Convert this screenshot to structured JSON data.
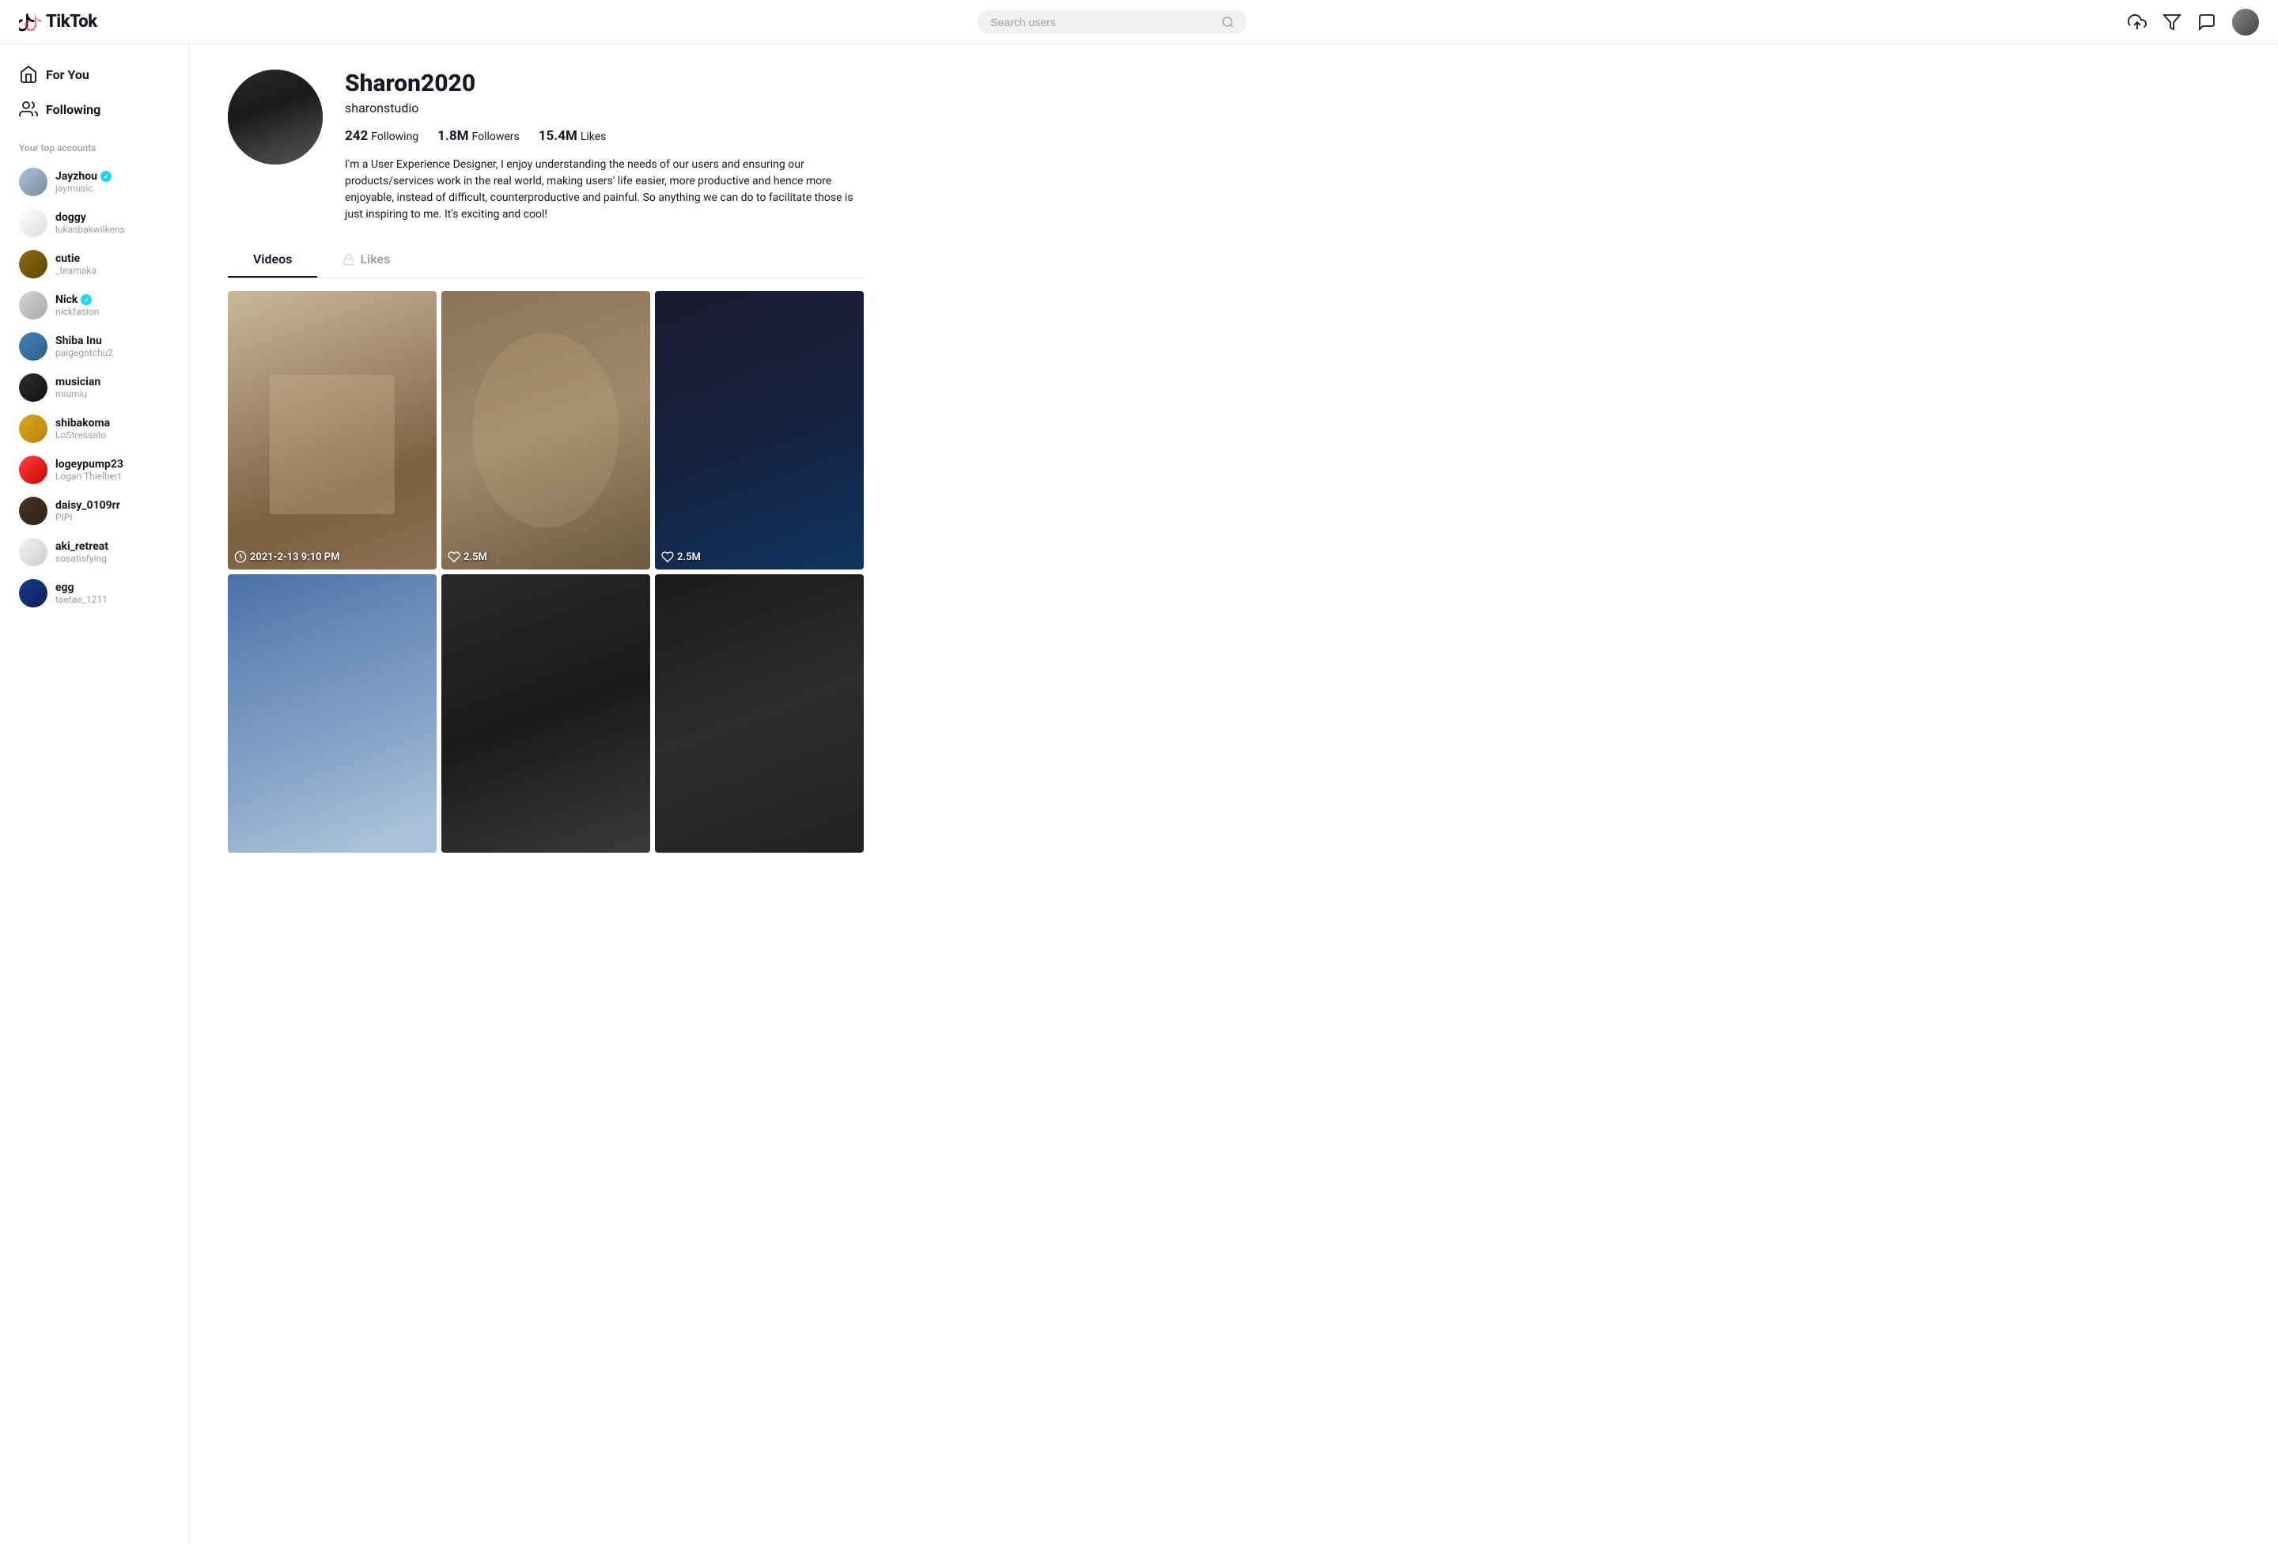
{
  "header": {
    "logo_text": "TikTok",
    "search_placeholder": "Search users"
  },
  "sidebar": {
    "nav_items": [
      {
        "id": "for-you",
        "label": "For You"
      },
      {
        "id": "following",
        "label": "Following"
      }
    ],
    "top_accounts_label": "Your top accounts",
    "accounts": [
      {
        "id": "jayzhou",
        "name": "Jayzhou",
        "username": "jaymusic",
        "verified": true,
        "av_class": "av-jay"
      },
      {
        "id": "doggy",
        "name": "doggy",
        "username": "lukasbakwilkens",
        "verified": false,
        "av_class": "av-dog"
      },
      {
        "id": "cutie",
        "name": "cutie",
        "username": "_teamaka",
        "verified": false,
        "av_class": "av-cutie"
      },
      {
        "id": "nick",
        "name": "Nick",
        "username": "nickfasion",
        "verified": true,
        "av_class": "av-nick"
      },
      {
        "id": "shiba-inu",
        "name": "Shiba Inu",
        "username": "paigegotchu2",
        "verified": false,
        "av_class": "av-shiba"
      },
      {
        "id": "musician",
        "name": "musician",
        "username": "miumiu",
        "verified": false,
        "av_class": "av-musician"
      },
      {
        "id": "shibakoma",
        "name": "shibakoma",
        "username": "LoStressato",
        "verified": false,
        "av_class": "av-shiba2"
      },
      {
        "id": "logeypump23",
        "name": "logeypump23",
        "username": "Logan Thielbert",
        "verified": false,
        "av_class": "av-logey"
      },
      {
        "id": "daisy_0109rr",
        "name": "daisy_0109rr",
        "username": "PIPI",
        "verified": false,
        "av_class": "av-daisy"
      },
      {
        "id": "aki_retreat",
        "name": "aki_retreat",
        "username": "sosatisfying",
        "verified": false,
        "av_class": "av-aki"
      },
      {
        "id": "egg",
        "name": "egg",
        "username": "taetae_1211",
        "verified": false,
        "av_class": "av-egg"
      }
    ]
  },
  "profile": {
    "display_name": "Sharon2020",
    "handle": "sharonstudio",
    "stats": {
      "following_count": "242",
      "following_label": "Following",
      "followers_count": "1.8M",
      "followers_label": "Followers",
      "likes_count": "15.4M",
      "likes_label": "Likes"
    },
    "bio": "I'm a User Experience Designer, I enjoy understanding the needs of our users and ensuring our products/services work in the real world, making users' life easier, more productive and hence more enjoyable, instead of difficult, counterproductive and painful. So anything we can do to facilitate those is just inspiring to me. It's exciting and cool!",
    "tabs": [
      {
        "id": "videos",
        "label": "Videos",
        "active": true
      },
      {
        "id": "likes",
        "label": "Likes",
        "active": false
      }
    ],
    "videos": [
      {
        "id": "v1",
        "likes": "",
        "time": "2021-2-13 9:10 PM",
        "thumb_class": "vt1",
        "show_time": true,
        "show_likes": false
      },
      {
        "id": "v2",
        "likes": "2.5M",
        "time": "",
        "thumb_class": "vt2",
        "show_time": false,
        "show_likes": true
      },
      {
        "id": "v3",
        "likes": "2.5M",
        "time": "",
        "thumb_class": "vt3",
        "show_time": false,
        "show_likes": true
      },
      {
        "id": "v4",
        "likes": "",
        "time": "",
        "thumb_class": "vt4",
        "show_time": false,
        "show_likes": false
      },
      {
        "id": "v5",
        "likes": "",
        "time": "",
        "thumb_class": "vt5",
        "show_time": false,
        "show_likes": false
      },
      {
        "id": "v6",
        "likes": "",
        "time": "",
        "thumb_class": "vt6",
        "show_time": false,
        "show_likes": false
      }
    ]
  }
}
